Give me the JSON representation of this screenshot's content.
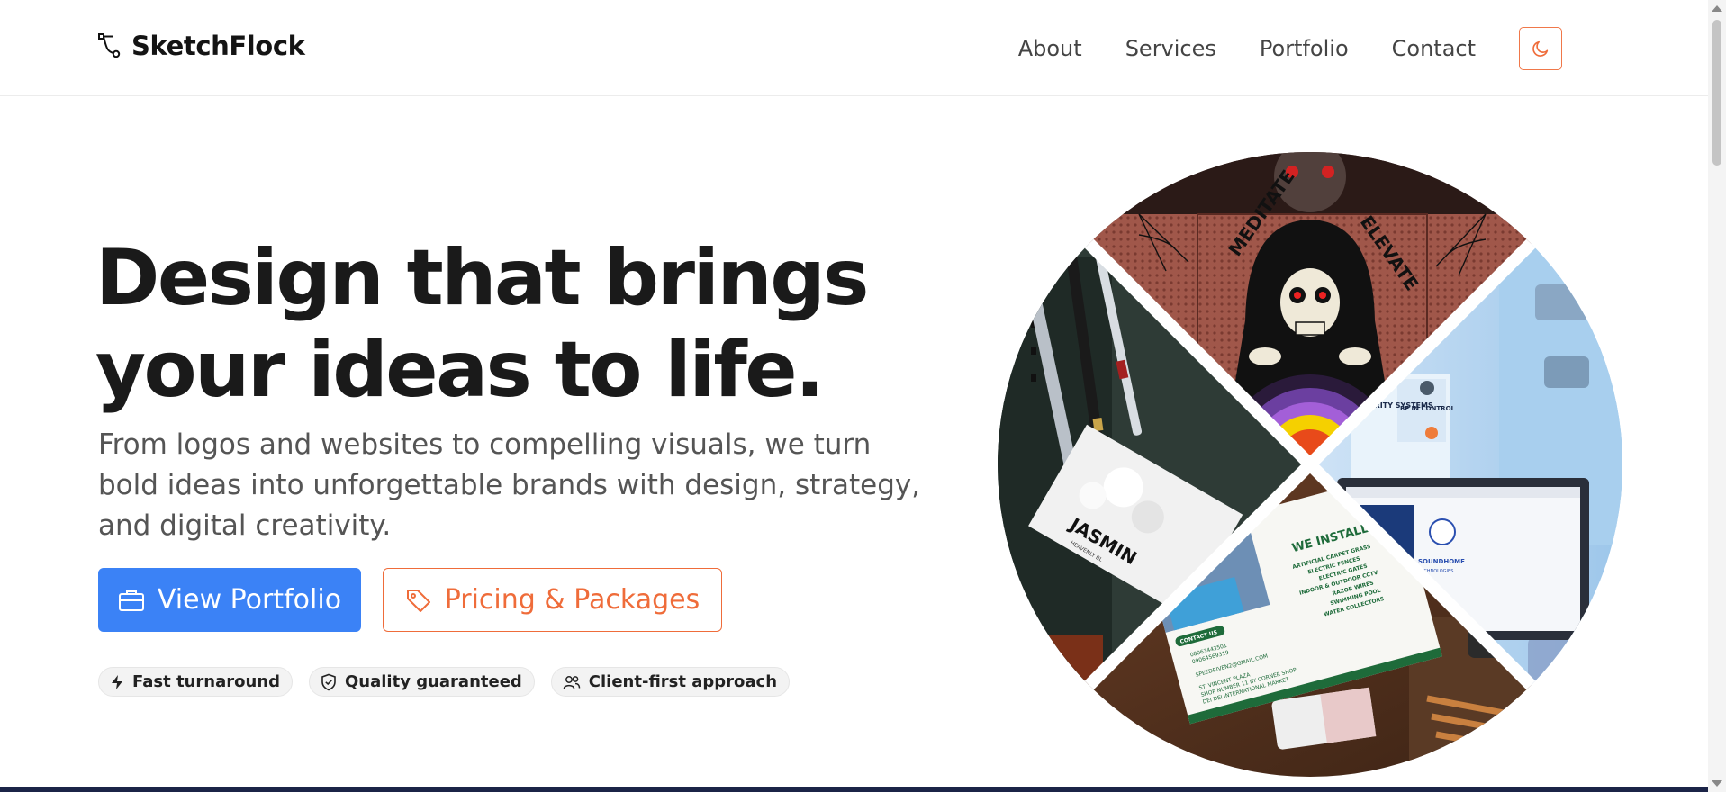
{
  "brand": {
    "name": "SketchFlock",
    "icon": "vector-pen-icon"
  },
  "nav": {
    "items": [
      {
        "label": "About"
      },
      {
        "label": "Services"
      },
      {
        "label": "Portfolio"
      },
      {
        "label": "Contact"
      }
    ],
    "theme_toggle_icon": "moon-icon"
  },
  "hero": {
    "title_line1": "Design that brings",
    "title_line2": "your ideas to life.",
    "description": "From logos and websites to compelling visuals, we turn bold ideas into unforgettable brands with design, strategy, and digital creativity.",
    "primary_button": {
      "label": "View Portfolio",
      "icon": "briefcase-icon"
    },
    "secondary_button": {
      "label": "Pricing & Packages",
      "icon": "tag-icon"
    },
    "badges": [
      {
        "label": "Fast turnaround",
        "icon": "lightning-icon"
      },
      {
        "label": "Quality guaranteed",
        "icon": "shield-check-icon"
      },
      {
        "label": "Client-first approach",
        "icon": "users-icon"
      }
    ]
  },
  "collage": {
    "poster_top": {
      "left_text": "MEDITATE",
      "right_text": "ELEVATE"
    },
    "flyer_right": {
      "heading": "SECURITY SYSTEMS",
      "sub": "BE IN CONTROL",
      "logo_text": "SOUNDHOME",
      "logo_sub": "TECHNOLOGIES"
    },
    "card_left": {
      "name": "JASMIN",
      "sub": "HEAVENLY BL"
    },
    "card_bottom": {
      "heading": "WE INSTALL",
      "services": [
        "ARTIFICIAL CARPET GRASS",
        "ELECTRIC FENCES",
        "ELECTRIC GATES",
        "INDOOR & OUTDOOR CCTV",
        "RAZOR WIRES",
        "SWIMMING POOL",
        "WATER COLLECTORS"
      ],
      "contact_label": "CONTACT US",
      "phones": [
        "08063443501",
        "09064569319"
      ],
      "email": "SPEEDRIVEN2@GMAIL.COM",
      "address": [
        "ST. VINCENT PLAZA",
        "SHOP NUMBER 11 BY CORNER SHOP",
        "DEI DEI INTERNATIONAL MARKET"
      ]
    }
  },
  "colors": {
    "primary": "#3b82f6",
    "accent": "#ef6c3a",
    "text": "#1a1a1a",
    "muted": "#555555"
  }
}
